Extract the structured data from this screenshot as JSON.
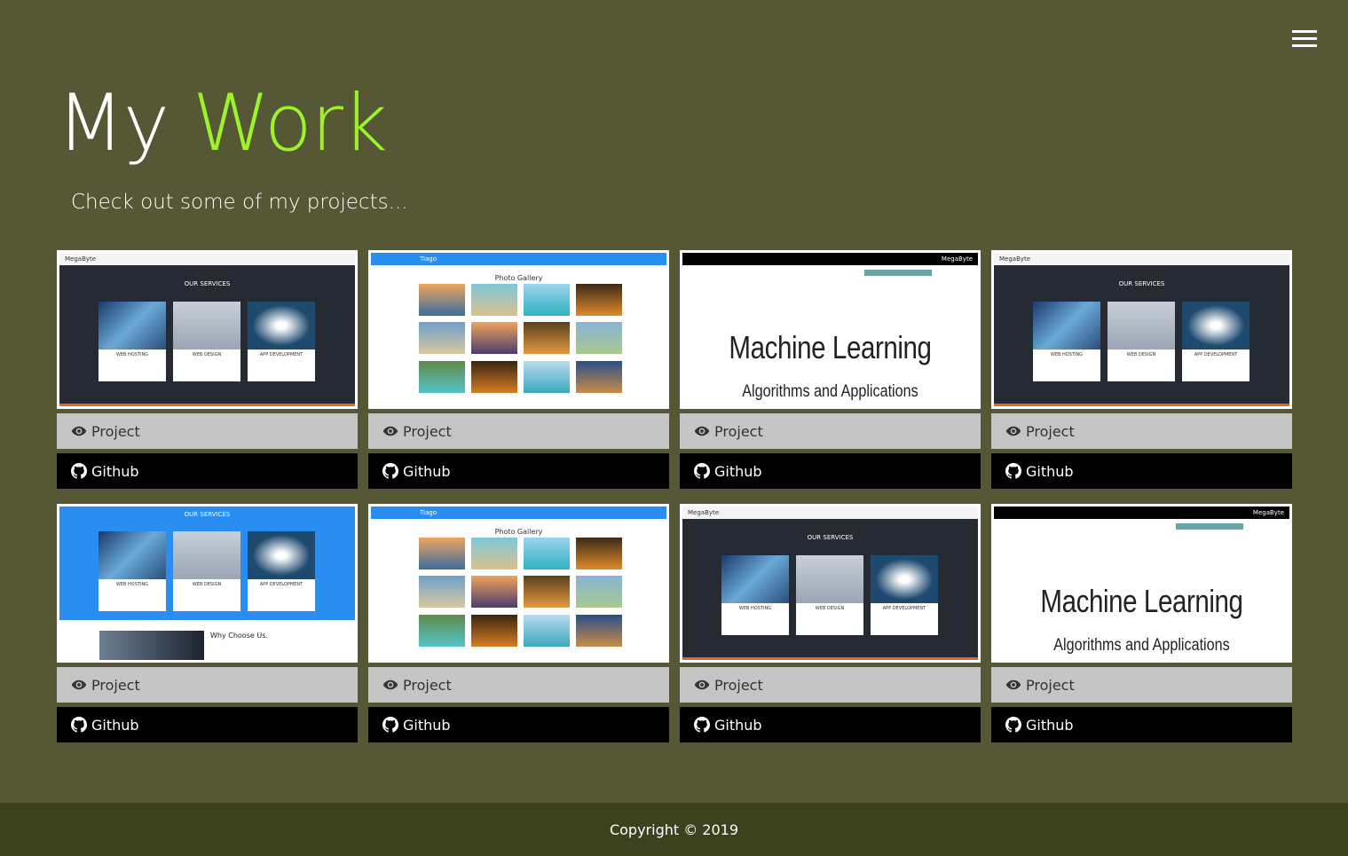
{
  "nav": {
    "menu_icon": "hamburger-icon"
  },
  "header": {
    "title_part1": "My",
    "title_part2": "Work",
    "subtitle": "Check out some of my projects...",
    "accent_color": "#9cf22c"
  },
  "projects": [
    {
      "preview": "services",
      "project_label": "Project",
      "github_label": "Github",
      "services_title": "OUR SERVICES",
      "brand": "MegaByte",
      "service_names": [
        "WEB HOSTING",
        "WEB DESIGN",
        "APP DEVELOPMENT"
      ]
    },
    {
      "preview": "gallery",
      "project_label": "Project",
      "github_label": "Github",
      "gallery_title": "Photo Gallery",
      "brand": "Tiago"
    },
    {
      "preview": "ml",
      "project_label": "Project",
      "github_label": "Github",
      "ml_title": "Machine Learning",
      "ml_subtitle": "Algorithms and Applications",
      "brand": "MegaByte"
    },
    {
      "preview": "services",
      "project_label": "Project",
      "github_label": "Github",
      "services_title": "OUR SERVICES",
      "brand": "MegaByte",
      "service_names": [
        "WEB HOSTING",
        "WEB DESIGN",
        "APP DEVELOPMENT"
      ]
    },
    {
      "preview": "services-blue",
      "project_label": "Project",
      "github_label": "Github",
      "services_title": "OUR SERVICES",
      "why_title": "Why Choose Us.",
      "service_names": [
        "WEB HOSTING",
        "WEB DESIGN",
        "APP DEVELOPMENT"
      ]
    },
    {
      "preview": "gallery",
      "project_label": "Project",
      "github_label": "Github",
      "gallery_title": "Photo Gallery",
      "brand": "Tiago"
    },
    {
      "preview": "services-framed",
      "project_label": "Project",
      "github_label": "Github",
      "services_title": "OUR SERVICES",
      "brand": "MegaByte",
      "service_names": [
        "WEB HOSTING",
        "WEB DESIGN",
        "APP DEVELOPMENT"
      ]
    },
    {
      "preview": "ml",
      "project_label": "Project",
      "github_label": "Github",
      "ml_title": "Machine Learning",
      "ml_subtitle": "Algorithms and Applications",
      "brand": "MegaByte"
    }
  ],
  "icons": {
    "project": "eye-icon",
    "github": "github-icon"
  },
  "colors": {
    "background": "#565734",
    "footer": "#3c411e",
    "project_button": "#c5c5c5",
    "github_button": "#000000"
  },
  "footer": {
    "copyright": "Copyright © 2019"
  }
}
